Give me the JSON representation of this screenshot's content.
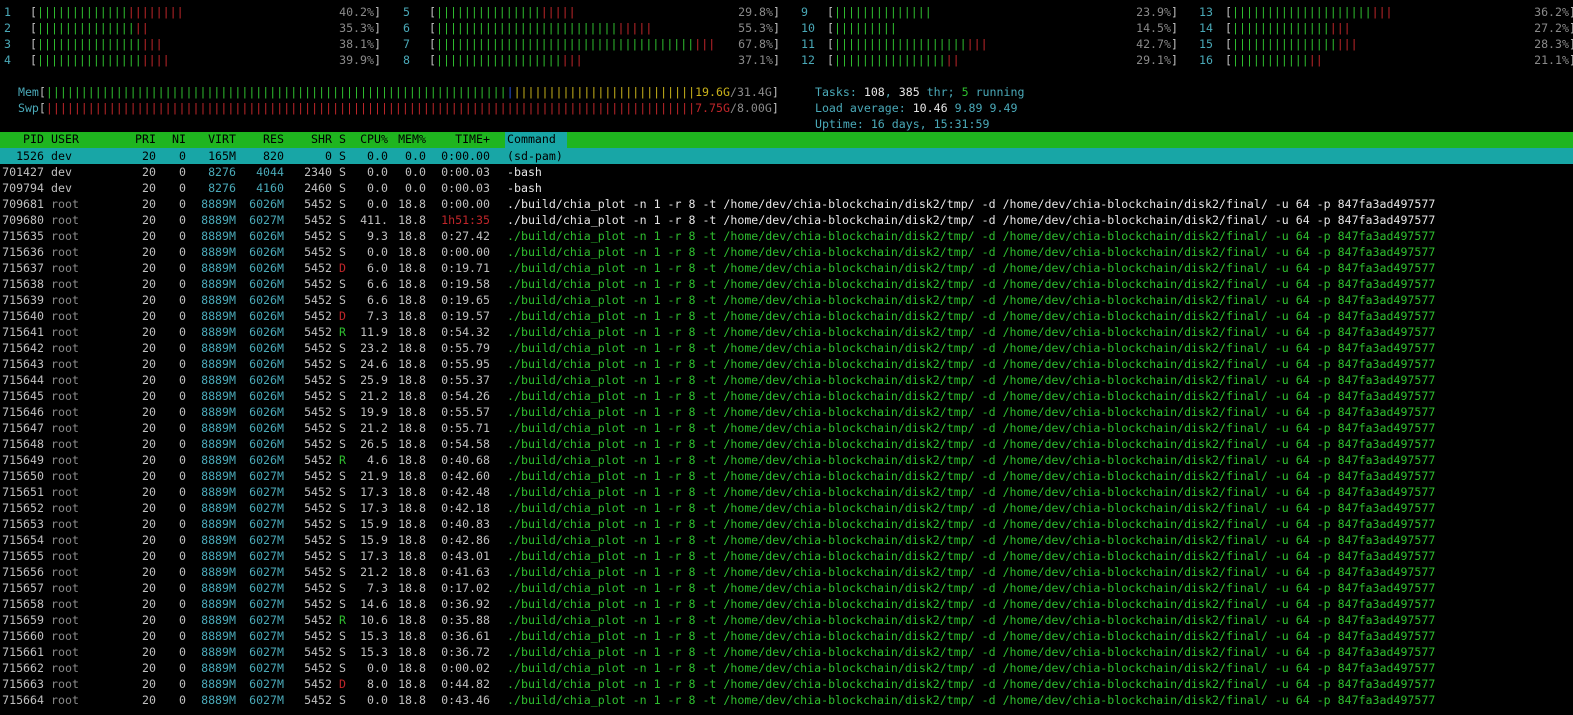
{
  "cpus": [
    {
      "id": "1",
      "g": 13,
      "r": 8,
      "pct": "40.2%"
    },
    {
      "id": "2",
      "g": 14,
      "r": 2,
      "pct": "35.3%"
    },
    {
      "id": "3",
      "g": 15,
      "r": 3,
      "pct": "38.1%"
    },
    {
      "id": "4",
      "g": 15,
      "r": 4,
      "pct": "39.9%"
    },
    {
      "id": "5",
      "g": 15,
      "r": 5,
      "pct": "29.8%"
    },
    {
      "id": "6",
      "g": 26,
      "r": 5,
      "pct": "55.3%"
    },
    {
      "id": "7",
      "g": 37,
      "r": 3,
      "pct": "67.8%"
    },
    {
      "id": "8",
      "g": 18,
      "r": 3,
      "pct": "37.1%"
    },
    {
      "id": "9",
      "g": 14,
      "r": 0,
      "pct": "23.9%"
    },
    {
      "id": "10",
      "g": 9,
      "r": 0,
      "pct": "14.5%"
    },
    {
      "id": "11",
      "g": 19,
      "r": 3,
      "pct": "42.7%"
    },
    {
      "id": "12",
      "g": 16,
      "r": 2,
      "pct": "29.1%"
    },
    {
      "id": "13",
      "g": 20,
      "r": 3,
      "pct": "36.2%"
    },
    {
      "id": "14",
      "g": 14,
      "r": 3,
      "pct": "27.2%"
    },
    {
      "id": "15",
      "g": 15,
      "r": 3,
      "pct": "28.3%"
    },
    {
      "id": "16",
      "g": 11,
      "r": 2,
      "pct": "21.1%"
    }
  ],
  "mem": {
    "label": "Mem",
    "used": "19.6G",
    "total": "31.4G"
  },
  "swp": {
    "label": "Swp",
    "used": "7.75G",
    "total": "8.00G"
  },
  "tasks": {
    "label": "Tasks: ",
    "count": "108",
    "sep1": ", ",
    "thr": "385",
    "thr_label": " thr; ",
    "running": "5",
    "running_label": " running"
  },
  "load": {
    "label": "Load average: ",
    "v1": "10.46",
    "v2": "9.89",
    "v3": "9.49"
  },
  "uptime": {
    "label": "Uptime: ",
    "value": "16 days, 15:31:59"
  },
  "columns": {
    "pid": "PID",
    "user": "USER",
    "pri": "PRI",
    "ni": "NI",
    "virt": "VIRT",
    "res": "RES",
    "shr": "SHR",
    "s": "S",
    "cpu": "CPU%",
    "mem": "MEM%",
    "time": "TIME+",
    "command": "Command"
  },
  "plot_command": "./build/chia_plot -n 1 -r 8 -t /home/dev/chia-blockchain/disk2/tmp/ -d /home/dev/chia-blockchain/disk2/final/ -u 64 -p 847fa3ad497577",
  "processes": [
    {
      "pid": "1526",
      "user": "dev",
      "pri": "20",
      "ni": "0",
      "virt": "165M",
      "res": "820",
      "shr": "0",
      "s": "S",
      "cpu": "0.0",
      "mem": "0.0",
      "time": "0:00.00",
      "cmd": "(sd-pam)",
      "sel": true
    },
    {
      "pid": "701427",
      "user": "dev",
      "pri": "20",
      "ni": "0",
      "virt": "8276",
      "res": "4044",
      "shr": "2340",
      "s": "S",
      "cpu": "0.0",
      "mem": "0.0",
      "time": "0:00.03",
      "cmd": "-bash"
    },
    {
      "pid": "709794",
      "user": "dev",
      "pri": "20",
      "ni": "0",
      "virt": "8276",
      "res": "4160",
      "shr": "2460",
      "s": "S",
      "cpu": "0.0",
      "mem": "0.0",
      "time": "0:00.03",
      "cmd": "-bash"
    },
    {
      "pid": "709681",
      "user": "root",
      "pri": "20",
      "ni": "0",
      "virt": "8889M",
      "res": "6026M",
      "shr": "5452",
      "s": "S",
      "cpu": "0.0",
      "mem": "18.8",
      "time": "0:00.00",
      "plot": true,
      "main": true
    },
    {
      "pid": "709680",
      "user": "root",
      "pri": "20",
      "ni": "0",
      "virt": "8889M",
      "res": "6027M",
      "shr": "5452",
      "s": "S",
      "cpu": "411.",
      "mem": "18.8",
      "time": "1h51:35",
      "plot": true,
      "main": true
    },
    {
      "pid": "715635",
      "user": "root",
      "pri": "20",
      "ni": "0",
      "virt": "8889M",
      "res": "6026M",
      "shr": "5452",
      "s": "S",
      "cpu": "9.3",
      "mem": "18.8",
      "time": "0:27.42",
      "plot": true
    },
    {
      "pid": "715636",
      "user": "root",
      "pri": "20",
      "ni": "0",
      "virt": "8889M",
      "res": "6026M",
      "shr": "5452",
      "s": "S",
      "cpu": "0.0",
      "mem": "18.8",
      "time": "0:00.00",
      "plot": true
    },
    {
      "pid": "715637",
      "user": "root",
      "pri": "20",
      "ni": "0",
      "virt": "8889M",
      "res": "6026M",
      "shr": "5452",
      "s": "D",
      "cpu": "6.0",
      "mem": "18.8",
      "time": "0:19.71",
      "plot": true
    },
    {
      "pid": "715638",
      "user": "root",
      "pri": "20",
      "ni": "0",
      "virt": "8889M",
      "res": "6026M",
      "shr": "5452",
      "s": "S",
      "cpu": "6.6",
      "mem": "18.8",
      "time": "0:19.58",
      "plot": true
    },
    {
      "pid": "715639",
      "user": "root",
      "pri": "20",
      "ni": "0",
      "virt": "8889M",
      "res": "6026M",
      "shr": "5452",
      "s": "S",
      "cpu": "6.6",
      "mem": "18.8",
      "time": "0:19.65",
      "plot": true
    },
    {
      "pid": "715640",
      "user": "root",
      "pri": "20",
      "ni": "0",
      "virt": "8889M",
      "res": "6026M",
      "shr": "5452",
      "s": "D",
      "cpu": "7.3",
      "mem": "18.8",
      "time": "0:19.57",
      "plot": true
    },
    {
      "pid": "715641",
      "user": "root",
      "pri": "20",
      "ni": "0",
      "virt": "8889M",
      "res": "6026M",
      "shr": "5452",
      "s": "R",
      "cpu": "11.9",
      "mem": "18.8",
      "time": "0:54.32",
      "plot": true
    },
    {
      "pid": "715642",
      "user": "root",
      "pri": "20",
      "ni": "0",
      "virt": "8889M",
      "res": "6026M",
      "shr": "5452",
      "s": "S",
      "cpu": "23.2",
      "mem": "18.8",
      "time": "0:55.79",
      "plot": true
    },
    {
      "pid": "715643",
      "user": "root",
      "pri": "20",
      "ni": "0",
      "virt": "8889M",
      "res": "6026M",
      "shr": "5452",
      "s": "S",
      "cpu": "24.6",
      "mem": "18.8",
      "time": "0:55.95",
      "plot": true
    },
    {
      "pid": "715644",
      "user": "root",
      "pri": "20",
      "ni": "0",
      "virt": "8889M",
      "res": "6026M",
      "shr": "5452",
      "s": "S",
      "cpu": "25.9",
      "mem": "18.8",
      "time": "0:55.37",
      "plot": true
    },
    {
      "pid": "715645",
      "user": "root",
      "pri": "20",
      "ni": "0",
      "virt": "8889M",
      "res": "6026M",
      "shr": "5452",
      "s": "S",
      "cpu": "21.2",
      "mem": "18.8",
      "time": "0:54.26",
      "plot": true
    },
    {
      "pid": "715646",
      "user": "root",
      "pri": "20",
      "ni": "0",
      "virt": "8889M",
      "res": "6026M",
      "shr": "5452",
      "s": "S",
      "cpu": "19.9",
      "mem": "18.8",
      "time": "0:55.57",
      "plot": true
    },
    {
      "pid": "715647",
      "user": "root",
      "pri": "20",
      "ni": "0",
      "virt": "8889M",
      "res": "6026M",
      "shr": "5452",
      "s": "S",
      "cpu": "21.2",
      "mem": "18.8",
      "time": "0:55.71",
      "plot": true
    },
    {
      "pid": "715648",
      "user": "root",
      "pri": "20",
      "ni": "0",
      "virt": "8889M",
      "res": "6026M",
      "shr": "5452",
      "s": "S",
      "cpu": "26.5",
      "mem": "18.8",
      "time": "0:54.58",
      "plot": true
    },
    {
      "pid": "715649",
      "user": "root",
      "pri": "20",
      "ni": "0",
      "virt": "8889M",
      "res": "6026M",
      "shr": "5452",
      "s": "R",
      "cpu": "4.6",
      "mem": "18.8",
      "time": "0:40.68",
      "plot": true
    },
    {
      "pid": "715650",
      "user": "root",
      "pri": "20",
      "ni": "0",
      "virt": "8889M",
      "res": "6027M",
      "shr": "5452",
      "s": "S",
      "cpu": "21.9",
      "mem": "18.8",
      "time": "0:42.60",
      "plot": true
    },
    {
      "pid": "715651",
      "user": "root",
      "pri": "20",
      "ni": "0",
      "virt": "8889M",
      "res": "6027M",
      "shr": "5452",
      "s": "S",
      "cpu": "17.3",
      "mem": "18.8",
      "time": "0:42.48",
      "plot": true
    },
    {
      "pid": "715652",
      "user": "root",
      "pri": "20",
      "ni": "0",
      "virt": "8889M",
      "res": "6027M",
      "shr": "5452",
      "s": "S",
      "cpu": "17.3",
      "mem": "18.8",
      "time": "0:42.18",
      "plot": true
    },
    {
      "pid": "715653",
      "user": "root",
      "pri": "20",
      "ni": "0",
      "virt": "8889M",
      "res": "6027M",
      "shr": "5452",
      "s": "S",
      "cpu": "15.9",
      "mem": "18.8",
      "time": "0:40.83",
      "plot": true
    },
    {
      "pid": "715654",
      "user": "root",
      "pri": "20",
      "ni": "0",
      "virt": "8889M",
      "res": "6027M",
      "shr": "5452",
      "s": "S",
      "cpu": "15.9",
      "mem": "18.8",
      "time": "0:42.86",
      "plot": true
    },
    {
      "pid": "715655",
      "user": "root",
      "pri": "20",
      "ni": "0",
      "virt": "8889M",
      "res": "6027M",
      "shr": "5452",
      "s": "S",
      "cpu": "17.3",
      "mem": "18.8",
      "time": "0:43.01",
      "plot": true
    },
    {
      "pid": "715656",
      "user": "root",
      "pri": "20",
      "ni": "0",
      "virt": "8889M",
      "res": "6027M",
      "shr": "5452",
      "s": "S",
      "cpu": "21.2",
      "mem": "18.8",
      "time": "0:41.63",
      "plot": true
    },
    {
      "pid": "715657",
      "user": "root",
      "pri": "20",
      "ni": "0",
      "virt": "8889M",
      "res": "6027M",
      "shr": "5452",
      "s": "S",
      "cpu": "7.3",
      "mem": "18.8",
      "time": "0:17.02",
      "plot": true
    },
    {
      "pid": "715658",
      "user": "root",
      "pri": "20",
      "ni": "0",
      "virt": "8889M",
      "res": "6027M",
      "shr": "5452",
      "s": "S",
      "cpu": "14.6",
      "mem": "18.8",
      "time": "0:36.92",
      "plot": true
    },
    {
      "pid": "715659",
      "user": "root",
      "pri": "20",
      "ni": "0",
      "virt": "8889M",
      "res": "6027M",
      "shr": "5452",
      "s": "R",
      "cpu": "10.6",
      "mem": "18.8",
      "time": "0:35.88",
      "plot": true
    },
    {
      "pid": "715660",
      "user": "root",
      "pri": "20",
      "ni": "0",
      "virt": "8889M",
      "res": "6027M",
      "shr": "5452",
      "s": "S",
      "cpu": "15.3",
      "mem": "18.8",
      "time": "0:36.61",
      "plot": true
    },
    {
      "pid": "715661",
      "user": "root",
      "pri": "20",
      "ni": "0",
      "virt": "8889M",
      "res": "6027M",
      "shr": "5452",
      "s": "S",
      "cpu": "15.3",
      "mem": "18.8",
      "time": "0:36.72",
      "plot": true
    },
    {
      "pid": "715662",
      "user": "root",
      "pri": "20",
      "ni": "0",
      "virt": "8889M",
      "res": "6027M",
      "shr": "5452",
      "s": "S",
      "cpu": "0.0",
      "mem": "18.8",
      "time": "0:00.02",
      "plot": true
    },
    {
      "pid": "715663",
      "user": "root",
      "pri": "20",
      "ni": "0",
      "virt": "8889M",
      "res": "6027M",
      "shr": "5452",
      "s": "D",
      "cpu": "8.0",
      "mem": "18.8",
      "time": "0:44.82",
      "plot": true
    },
    {
      "pid": "715664",
      "user": "root",
      "pri": "20",
      "ni": "0",
      "virt": "8889M",
      "res": "6027M",
      "shr": "5452",
      "s": "S",
      "cpu": "0.0",
      "mem": "18.8",
      "time": "0:43.46",
      "plot": true
    }
  ],
  "colors": {
    "header_bg": "#1fb51f",
    "selected_bg": "#18a6a6",
    "bar_green": "#2fbf2f",
    "bar_red": "#c0262a",
    "cyan": "#4aa9b8"
  }
}
